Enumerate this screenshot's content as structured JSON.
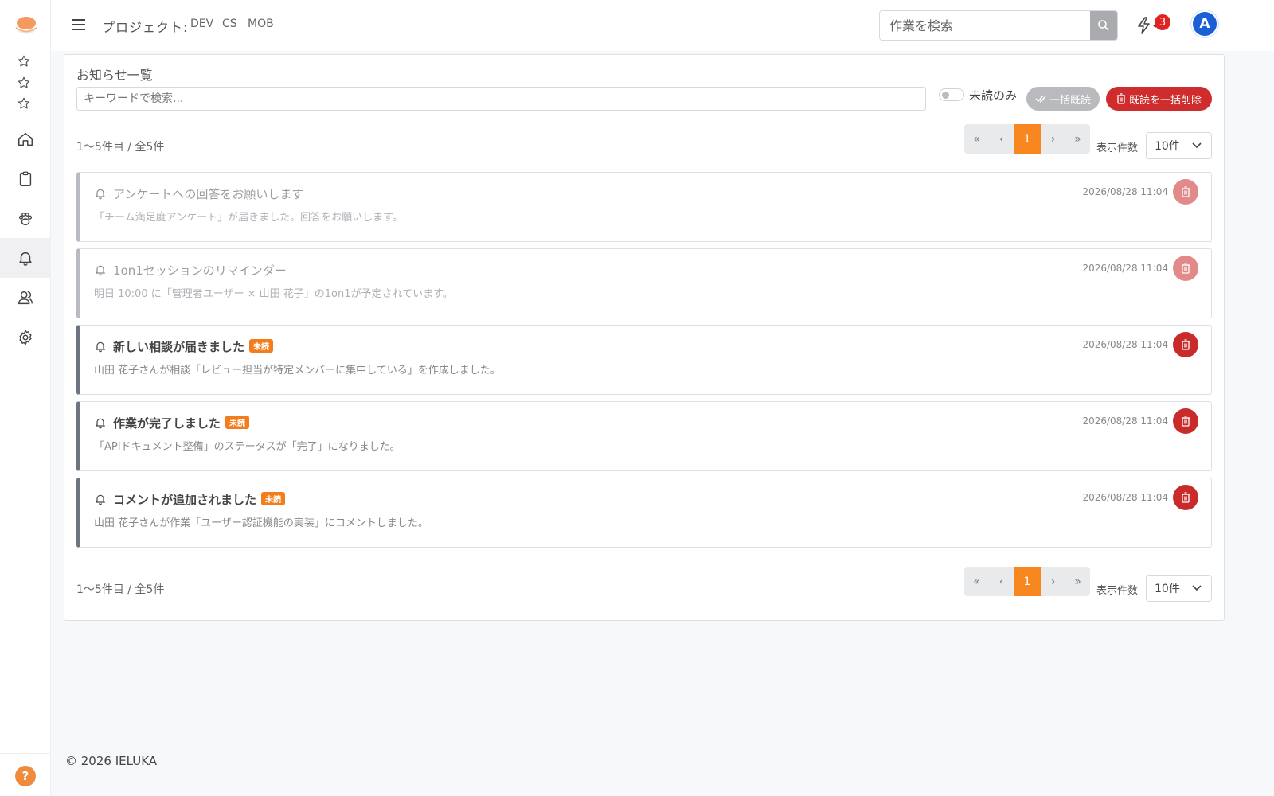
{
  "header": {
    "project_label": "プロジェクト:",
    "projects": [
      "DEV",
      "CS",
      "MOB"
    ],
    "search_placeholder": "作業を検索",
    "notification_count": "3",
    "avatar_initial": "A"
  },
  "panel": {
    "title": "お知らせ一覧",
    "keyword_placeholder": "キーワードで検索...",
    "unread_only_label": "未読のみ",
    "mark_all_read_label": "一括既読",
    "delete_read_label": "既読を一括削除",
    "range_text": "1〜5件目 / 全5件",
    "pager": {
      "first": "«",
      "prev": "‹",
      "current": "1",
      "next": "›",
      "last": "»"
    },
    "per_page_label": "表示件数",
    "per_page_value": "10件"
  },
  "notices": [
    {
      "title": "アンケートへの回答をお願いします",
      "body": "「チーム満足度アンケート」が届きました。回答をお願いします。",
      "date": "2026/08/28 11:04",
      "unread": false,
      "badge": ""
    },
    {
      "title": "1on1セッションのリマインダー",
      "body": "明日 10:00 に「管理者ユーザー × 山田 花子」の1on1が予定されています。",
      "date": "2026/08/28 11:04",
      "unread": false,
      "badge": ""
    },
    {
      "title": "新しい相談が届きました",
      "body": "山田 花子さんが相談「レビュー担当が特定メンバーに集中している」を作成しました。",
      "date": "2026/08/28 11:04",
      "unread": true,
      "badge": "未読"
    },
    {
      "title": "作業が完了しました",
      "body": "「APIドキュメント整備」のステータスが「完了」になりました。",
      "date": "2026/08/28 11:04",
      "unread": true,
      "badge": "未読"
    },
    {
      "title": "コメントが追加されました",
      "body": "山田 花子さんが作業「ユーザー認証機能の実装」にコメントしました。",
      "date": "2026/08/28 11:04",
      "unread": true,
      "badge": "未読"
    }
  ],
  "footer": {
    "copyright": "© 2026 IELUKA"
  },
  "sidebar": {
    "help": "?",
    "icons": [
      "star-icon",
      "star-icon",
      "star-icon",
      "home-icon",
      "clipboard-icon",
      "paw-icon",
      "bell-icon",
      "users-icon",
      "gear-icon"
    ]
  },
  "colors": {
    "accent_orange": "#f7871e",
    "danger_red": "#c92a2a",
    "avatar_blue": "#1a5fd6"
  }
}
